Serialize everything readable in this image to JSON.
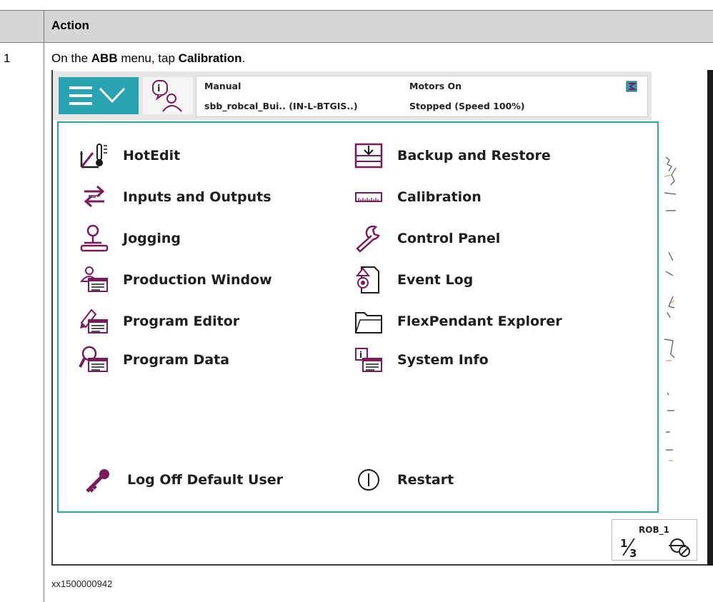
{
  "table": {
    "header": "Action",
    "row_number": "1",
    "instruction_pre": "On the ",
    "instruction_menu": "ABB",
    "instruction_mid": " menu, tap ",
    "instruction_target": "Calibration",
    "instruction_end": ".",
    "caption": "xx1500000942"
  },
  "topbar": {
    "mode": "Manual",
    "system": "sbb_robcal_Bui.. (IN-L-BTGIS..)",
    "motors": "Motors On",
    "state": "Stopped (Speed 100%)"
  },
  "menu": {
    "left": [
      {
        "label": "HotEdit",
        "icon": "hotedit-icon"
      },
      {
        "label": "Inputs and Outputs",
        "icon": "inputs-outputs-icon"
      },
      {
        "label": "Jogging",
        "icon": "joystick-icon"
      },
      {
        "label": "Production Window",
        "icon": "production-window-icon"
      },
      {
        "label": "Program Editor",
        "icon": "program-editor-icon"
      },
      {
        "label": "Program Data",
        "icon": "program-data-icon"
      }
    ],
    "right": [
      {
        "label": "Backup and Restore",
        "icon": "backup-restore-icon"
      },
      {
        "label": "Calibration",
        "icon": "calibration-icon"
      },
      {
        "label": "Control Panel",
        "icon": "wrench-icon"
      },
      {
        "label": "Event Log",
        "icon": "event-log-icon"
      },
      {
        "label": "FlexPendant Explorer",
        "icon": "folder-icon"
      },
      {
        "label": "System Info",
        "icon": "system-info-icon"
      }
    ],
    "log_off": "Log Off Default User",
    "restart": "Restart"
  },
  "quickset": {
    "robot": "ROB_1",
    "fraction": "1/3"
  },
  "colors": {
    "accent": "#2aa3b3",
    "icon_purple": "#7a1a5a",
    "header_gray": "#d6d6d6"
  }
}
